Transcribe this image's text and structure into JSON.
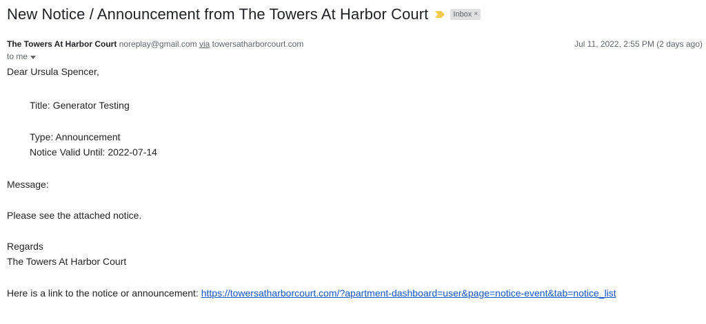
{
  "email": {
    "subject": "New Notice / Announcement from The Towers At Harbor Court",
    "label": "Inbox",
    "label_close": "×",
    "sender_name": "The Towers At Harbor Court",
    "sender_email": "noreplay@gmail.com",
    "via": "via",
    "via_domain": "towersatharborcourt.com",
    "date": "Jul 11, 2022, 2:55 PM (2 days ago)",
    "to": "to me",
    "colors": {
      "importance": "#f2c94c",
      "link": "#1155cc"
    }
  },
  "body": {
    "greeting": "Dear Ursula Spencer,",
    "title": "Title: Generator Testing",
    "type": "Type: Announcement",
    "valid_until": "Notice Valid Until: 2022-07-14",
    "message_label": "Message:",
    "message": "Please see the attached notice.",
    "regards": "Regards",
    "signature": "The Towers At Harbor Court",
    "link_intro": "Here is a link to the notice or announcement:",
    "link_url": "https://towersatharborcourt.com/?apartment-dashboard=user&page=notice-event&tab=notice_list"
  }
}
